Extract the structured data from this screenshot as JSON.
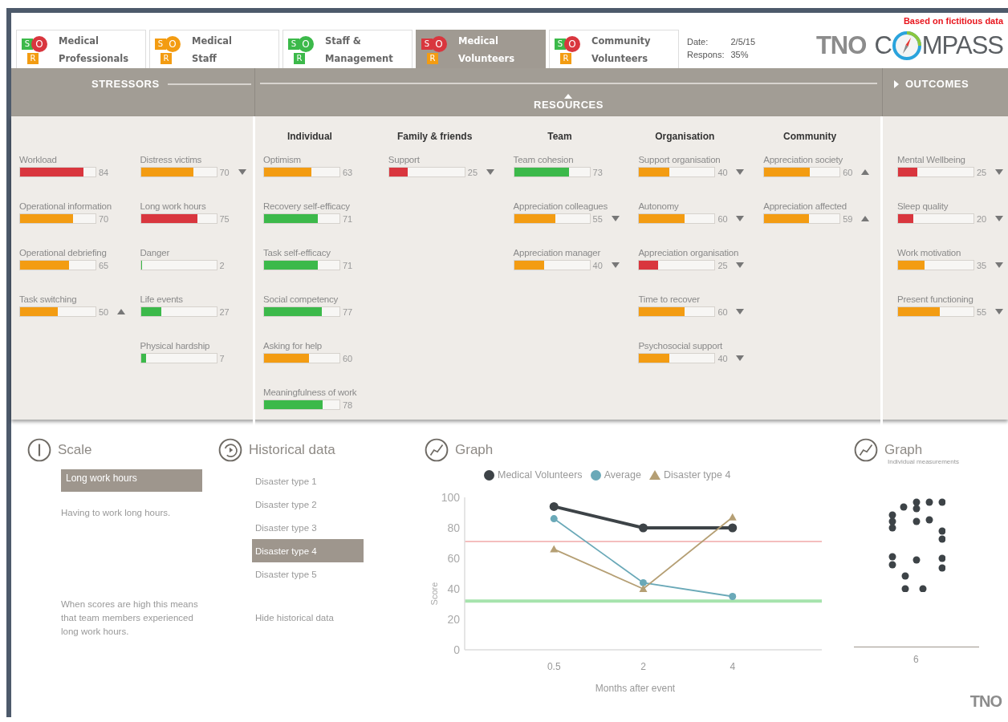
{
  "notice": "Based on fictitious data",
  "tabs": [
    {
      "label": "Medical\nProfessionals",
      "selected": false,
      "sor": [
        {
          "letter": "S",
          "kind": "square",
          "color": "#3cb94a"
        },
        {
          "letter": "O",
          "kind": "circle",
          "color": "#d9363e"
        },
        {
          "letter": "R",
          "kind": "square",
          "color": "#f39c12"
        }
      ]
    },
    {
      "label": "Medical\nStaff",
      "selected": false,
      "sor": [
        {
          "letter": "S",
          "kind": "square",
          "color": "#f39c12"
        },
        {
          "letter": "O",
          "kind": "circle",
          "color": "#f39c12"
        },
        {
          "letter": "R",
          "kind": "square",
          "color": "#f39c12"
        }
      ]
    },
    {
      "label": "Staff &\nManagement",
      "selected": false,
      "sor": [
        {
          "letter": "S",
          "kind": "square",
          "color": "#3cb94a"
        },
        {
          "letter": "O",
          "kind": "circle",
          "color": "#3cb94a"
        },
        {
          "letter": "R",
          "kind": "square",
          "color": "#3cb94a"
        }
      ]
    },
    {
      "label": "Medical\nVolunteers",
      "selected": true,
      "sor": [
        {
          "letter": "S",
          "kind": "square",
          "color": "#d9363e"
        },
        {
          "letter": "O",
          "kind": "circle",
          "color": "#d9363e"
        },
        {
          "letter": "R",
          "kind": "square",
          "color": "#f39c12"
        }
      ]
    },
    {
      "label": "Community\nVolunteers",
      "selected": false,
      "sor": [
        {
          "letter": "S",
          "kind": "square",
          "color": "#3cb94a"
        },
        {
          "letter": "O",
          "kind": "circle",
          "color": "#d9363e"
        },
        {
          "letter": "R",
          "kind": "square",
          "color": "#f39c12"
        }
      ]
    }
  ],
  "info": [
    {
      "label": "Date:",
      "value": "2/5/15"
    },
    {
      "label": "Respons:",
      "value": "35%"
    }
  ],
  "logo": {
    "left": "TNO",
    "c": "C",
    "right": "MPASS"
  },
  "band": {
    "stressors": "STRESSORS",
    "resources": "RESOURCES",
    "outcomes": "OUTCOMES"
  },
  "stressors": {
    "columns": [
      {
        "items": [
          {
            "label": "Workload",
            "value": "84",
            "level": 0.84,
            "color": "#d9363e",
            "kind": "flat"
          },
          {
            "label": "Operational information",
            "value": "70",
            "level": 0.7,
            "color": "#f39c12",
            "kind": "flat"
          },
          {
            "label": "Operational debriefing",
            "value": "65",
            "level": 0.65,
            "color": "#f39c12",
            "kind": "flat"
          },
          {
            "label": "Task switching",
            "value": "50",
            "level": 0.5,
            "color": "#f39c12",
            "kind": "up"
          }
        ]
      },
      {
        "items": [
          {
            "label": "Distress victims",
            "value": "70",
            "level": 0.7,
            "color": "#f39c12",
            "kind": "down"
          },
          {
            "label": "Long work hours",
            "value": "75",
            "level": 0.75,
            "color": "#d9363e",
            "kind": "flat"
          },
          {
            "label": "Danger",
            "value": "2",
            "level": 0.02,
            "color": "#3cb94a",
            "kind": "flat"
          },
          {
            "label": "Life events",
            "value": "27",
            "level": 0.27,
            "color": "#3cb94a",
            "kind": "flat"
          },
          {
            "label": "Physical hardship",
            "value": "7",
            "level": 0.07,
            "color": "#3cb94a",
            "kind": "flat"
          }
        ]
      }
    ]
  },
  "resources": {
    "groups": [
      {
        "title": "Individual",
        "items": [
          {
            "label": "Optimism",
            "value": "63",
            "level": 0.63,
            "color": "#f39c12",
            "kind": "flat"
          },
          {
            "label": "Recovery self-efficacy",
            "value": "71",
            "level": 0.71,
            "color": "#3cb94a",
            "kind": "flat"
          },
          {
            "label": "Task self-efficacy",
            "value": "71",
            "level": 0.71,
            "color": "#3cb94a",
            "kind": "flat"
          },
          {
            "label": "Social competency",
            "value": "77",
            "level": 0.77,
            "color": "#3cb94a",
            "kind": "flat"
          },
          {
            "label": "Asking for help",
            "value": "60",
            "level": 0.6,
            "color": "#f39c12",
            "kind": "flat"
          },
          {
            "label": "Meaningfulness of work",
            "value": "78",
            "level": 0.78,
            "color": "#3cb94a",
            "kind": "flat"
          }
        ]
      },
      {
        "title": "Family & friends",
        "items": [
          {
            "label": "Support",
            "value": "25",
            "level": 0.25,
            "color": "#d9363e",
            "kind": "down"
          }
        ]
      },
      {
        "title": "Team",
        "items": [
          {
            "label": "Team cohesion",
            "value": "73",
            "level": 0.73,
            "color": "#3cb94a",
            "kind": "flat"
          },
          {
            "label": "Appreciation colleagues",
            "value": "55",
            "level": 0.55,
            "color": "#f39c12",
            "kind": "down"
          },
          {
            "label": "Appreciation manager",
            "value": "40",
            "level": 0.4,
            "color": "#f39c12",
            "kind": "down"
          }
        ]
      },
      {
        "title": "Organisation",
        "items": [
          {
            "label": "Support organisation",
            "value": "40",
            "level": 0.4,
            "color": "#f39c12",
            "kind": "down"
          },
          {
            "label": "Autonomy",
            "value": "60",
            "level": 0.6,
            "color": "#f39c12",
            "kind": "down"
          },
          {
            "label": "Appreciation organisation",
            "value": "25",
            "level": 0.25,
            "color": "#d9363e",
            "kind": "down"
          },
          {
            "label": "Time to recover",
            "value": "60",
            "level": 0.6,
            "color": "#f39c12",
            "kind": "down"
          },
          {
            "label": "Psychosocial support",
            "value": "40",
            "level": 0.4,
            "color": "#f39c12",
            "kind": "down"
          }
        ]
      },
      {
        "title": "Community",
        "items": [
          {
            "label": "Appreciation society",
            "value": "60",
            "level": 0.6,
            "color": "#f39c12",
            "kind": "up"
          },
          {
            "label": "Appreciation affected",
            "value": "59",
            "level": 0.59,
            "color": "#f39c12",
            "kind": "up"
          }
        ]
      }
    ]
  },
  "outcomes": {
    "items": [
      {
        "label": "Mental Wellbeing",
        "value": "25",
        "level": 0.25,
        "color": "#d9363e",
        "kind": "down"
      },
      {
        "label": "Sleep quality",
        "value": "20",
        "level": 0.2,
        "color": "#d9363e",
        "kind": "down"
      },
      {
        "label": "Work motivation",
        "value": "35",
        "level": 0.35,
        "color": "#f39c12",
        "kind": "down"
      },
      {
        "label": "Present functioning",
        "value": "55",
        "level": 0.55,
        "color": "#f39c12",
        "kind": "down"
      }
    ]
  },
  "scale": {
    "title": "Scale",
    "selected_item": "Long work hours",
    "description": "Having to work long hours.",
    "note": "When scores are high this means that team members experienced long work hours."
  },
  "historical": {
    "title": "Historical data",
    "items": [
      {
        "label": "Disaster type 1",
        "selected": false
      },
      {
        "label": "Disaster type 2",
        "selected": false
      },
      {
        "label": "Disaster type 3",
        "selected": false
      },
      {
        "label": "Disaster type 4",
        "selected": true
      },
      {
        "label": "Disaster type 5",
        "selected": false
      }
    ],
    "hide_link": "Hide historical data"
  },
  "graph": {
    "title": "Graph",
    "chart_data": {
      "type": "line",
      "xlabel": "Months after event",
      "ylabel": "Score",
      "categories": [
        "0.5",
        "2",
        "4"
      ],
      "ylim": [
        0,
        100
      ],
      "yticks": [
        0,
        20,
        40,
        60,
        80,
        100
      ],
      "series": [
        {
          "name": "Medical Volunteers",
          "color": "#3d4347",
          "marker": "circle",
          "values": [
            94,
            80,
            80
          ]
        },
        {
          "name": "Average",
          "color": "#6aa9b8",
          "marker": "circle",
          "values": [
            86,
            44,
            35
          ]
        },
        {
          "name": "Disaster type 4",
          "color": "#b59f74",
          "marker": "triangle",
          "values": [
            66,
            40,
            87
          ]
        }
      ],
      "ref_lines": [
        {
          "axis": "y",
          "value": 71,
          "color": "#f0a8a8"
        },
        {
          "axis": "y",
          "value": 32,
          "color": "#a6e3ad"
        }
      ]
    }
  },
  "graph2": {
    "title": "Graph",
    "subtitle": "Individual measurements",
    "x_label": "6"
  },
  "footer_logo": "TNO"
}
